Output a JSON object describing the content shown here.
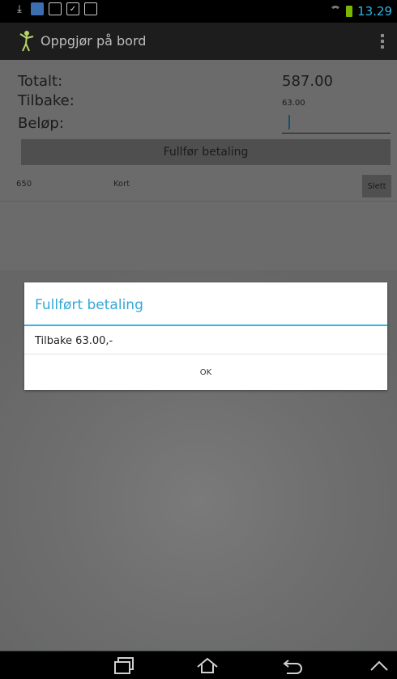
{
  "status_bar": {
    "time": "13.29",
    "left_icons": [
      "download-icon",
      "app-notification-icon",
      "image-icon",
      "checkbox-icon",
      "calendar-icon"
    ],
    "right_icons": [
      "wifi-icon",
      "battery-icon"
    ],
    "clock_color": "#33b5e5"
  },
  "action_bar": {
    "title": "Oppgjør på bord",
    "icon": "app-logo-icon",
    "overflow_icon": "overflow-menu-icon"
  },
  "summary": {
    "total_label": "Totalt:",
    "total_value": "587.00",
    "change_label": "Tilbake:",
    "change_value": "63.00",
    "amount_label": "Beløp:",
    "amount_value": ""
  },
  "complete_payment_button": "Fullfør betaling",
  "payments": [
    {
      "amount": "650",
      "type": "Kort",
      "delete_label": "Slett"
    }
  ],
  "dialog": {
    "title": "Fullført betaling",
    "message": "Tilbake 63.00,-",
    "ok_label": "OK",
    "accent_color": "#33b5e5"
  },
  "nav_bar": {
    "buttons": [
      "recent-apps-icon",
      "home-icon",
      "back-icon",
      "menu-up-icon"
    ]
  }
}
